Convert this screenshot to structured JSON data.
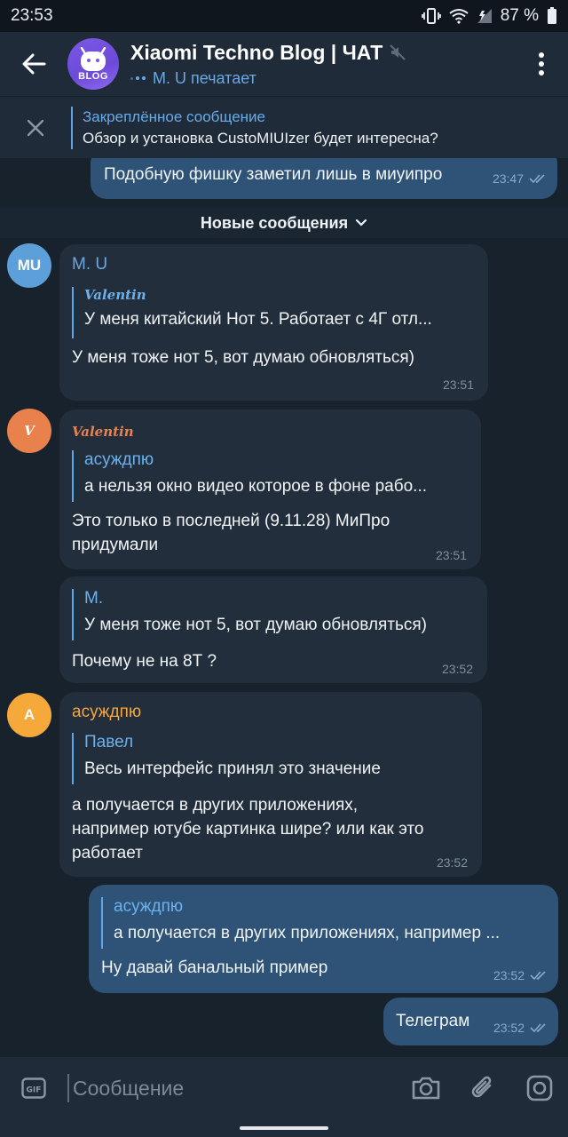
{
  "status_bar": {
    "time": "23:53",
    "battery": "87 %"
  },
  "header": {
    "title": "Xiaomi Techno Blog | ЧАТ",
    "subtitle": "M. U печатает",
    "avatar_text": "BLOG",
    "accent": "#69a8e6"
  },
  "pinned": {
    "title": "Закреплённое сообщение",
    "text": "Обзор и установка CustoMIUIzer будет интересна?"
  },
  "new_messages_label": "Новые сообщения",
  "messages": [
    {
      "text": "Подобную фишку заметил лишь в миуипро",
      "time": "23:47"
    },
    {
      "avatar": "MU",
      "sender": "M. U",
      "reply_name": "Valentin",
      "reply_text": "У меня китайский Нот 5. Работает с 4Г отл...",
      "text": "У меня тоже нот 5, вот думаю обновляться)",
      "time": "23:51"
    },
    {
      "avatar": "V",
      "sender": "Valentin",
      "reply_name": "асуждпю",
      "reply_text": "а нельзя окно видео которое в фоне рабо...",
      "text_line1": "Это только в последней (9.11.28) МиПро",
      "text_line2": "придумали",
      "time": "23:51"
    },
    {
      "reply_name": "M.",
      "reply_text": "У меня тоже нот 5, вот думаю обновляться)",
      "text": "Почему не на 8Т ?",
      "time": "23:52"
    },
    {
      "avatar": "A",
      "sender": "асуждпю",
      "reply_name": "Павел",
      "reply_text": "Весь интерфейс принял это значение",
      "text_line1": "а получается в других приложениях,",
      "text_line2": "например ютубе картинка шире? или как это",
      "text_line3": "работает",
      "time": "23:52"
    },
    {
      "reply_name": "асуждпю",
      "reply_text": "а получается в других приложениях, например ...",
      "text": "Ну давай банальный пример",
      "time": "23:52"
    },
    {
      "text": "Телеграм",
      "time": "23:52"
    }
  ],
  "input": {
    "placeholder": "Сообщение"
  },
  "colors": {
    "background": "#18222d",
    "bubble_in": "#222e3b",
    "bubble_out": "#2e5376",
    "avatar_mu": "#5d9fd8",
    "avatar_v": "#e8814b",
    "avatar_a": "#f4a93a",
    "sender_mu": "#69a8e6",
    "sender_v": "#e8814b",
    "sender_a": "#f4a93a"
  }
}
